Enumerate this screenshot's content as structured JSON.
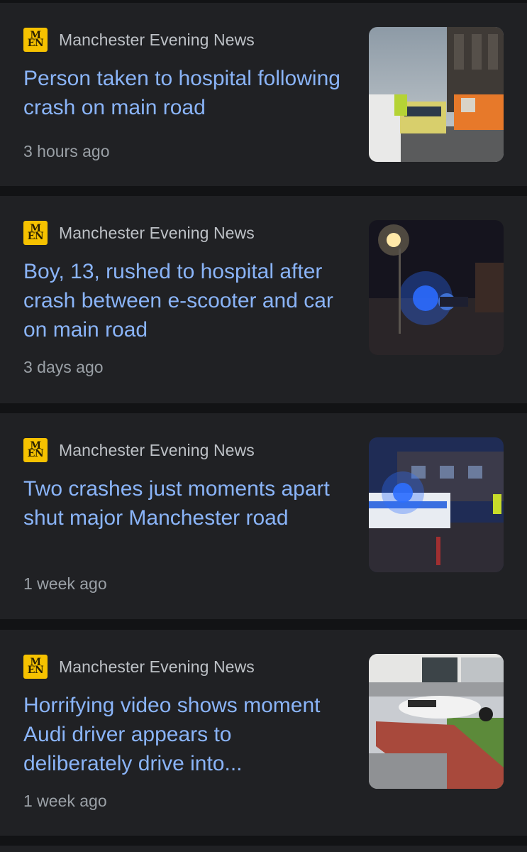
{
  "articles": [
    {
      "source": "Manchester Evening News",
      "logo_text": "MEN",
      "headline": "Person taken to hospital following crash on main road",
      "time": "3 hours ago",
      "thumbnail": "police-car-street-photo"
    },
    {
      "source": "Manchester Evening News",
      "logo_text": "MEN",
      "headline": "Boy, 13, rushed to hospital after crash between e-scooter and car on main road",
      "time": "3 days ago",
      "thumbnail": "night-blue-lights-photo"
    },
    {
      "source": "Manchester Evening News",
      "logo_text": "MEN",
      "headline": "Two crashes just moments apart shut major Manchester road",
      "time": "1 week ago",
      "thumbnail": "police-car-night-photo"
    },
    {
      "source": "Manchester Evening News",
      "logo_text": "MEN",
      "headline": "Horrifying video shows moment Audi driver appears to deliberately drive into...",
      "time": "1 week ago",
      "thumbnail": "crashed-car-wall-photo"
    }
  ],
  "colors": {
    "background": "#121315",
    "card": "#202124",
    "headline": "#8ab4f8",
    "source": "#bdc1c6",
    "time": "#9aa0a6",
    "logo": "#f6c200"
  }
}
